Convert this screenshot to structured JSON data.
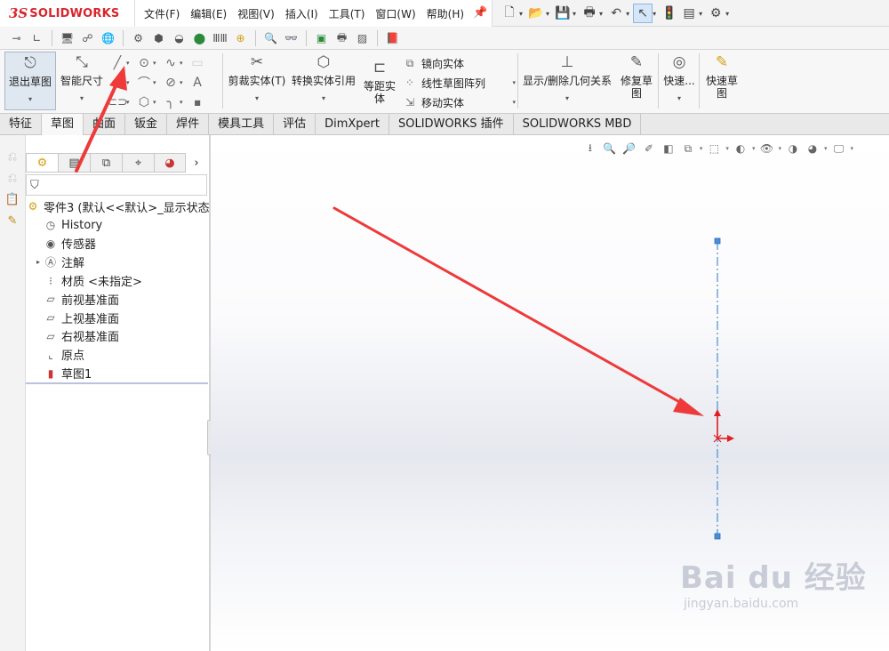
{
  "app": {
    "logo_ds": "3S",
    "logo_text": "SOLIDWORKS"
  },
  "menu": [
    "文件(F)",
    "编辑(E)",
    "视图(V)",
    "插入(I)",
    "工具(T)",
    "窗口(W)",
    "帮助(H)"
  ],
  "ribbon": {
    "exit_sketch": "退出草图",
    "smart_dim": "智能尺寸",
    "trim": "剪裁实体(T)",
    "convert": "转换实体引用",
    "offset_1": "等距实",
    "offset_2": "体",
    "mirror": "镜向实体",
    "linear_pattern": "线性草图阵列",
    "move": "移动实体",
    "display_relations": "显示/删除几何关系",
    "repair_1": "修复草",
    "repair_2": "图",
    "quick_snaps": "快速...",
    "rapid_1": "快速草",
    "rapid_2": "图"
  },
  "tabs": [
    "特征",
    "草图",
    "曲面",
    "钣金",
    "焊件",
    "模具工具",
    "评估",
    "DimXpert",
    "SOLIDWORKS 插件",
    "SOLIDWORKS MBD"
  ],
  "active_tab": "草图",
  "tree": {
    "part": "零件3  (默认<<默认>_显示状态",
    "items": [
      {
        "label": "History",
        "icon": "history-icon",
        "expandable": false
      },
      {
        "label": "传感器",
        "icon": "sensor-icon",
        "expandable": false
      },
      {
        "label": "注解",
        "icon": "annotation-icon",
        "expandable": true
      },
      {
        "label": "材质 <未指定>",
        "icon": "material-icon",
        "expandable": false
      },
      {
        "label": "前视基准面",
        "icon": "plane-icon",
        "expandable": false
      },
      {
        "label": "上视基准面",
        "icon": "plane-icon",
        "expandable": false
      },
      {
        "label": "右视基准面",
        "icon": "plane-icon",
        "expandable": false
      },
      {
        "label": "原点",
        "icon": "origin-icon",
        "expandable": false
      },
      {
        "label": "草图1",
        "icon": "sketch-icon",
        "expandable": false
      }
    ]
  },
  "watermark": {
    "main": "Bai du 经验",
    "sub": "jingyan.baidu.com"
  },
  "colors": {
    "brand": "#d7262c",
    "centerline": "#4a8fd6",
    "arrow": "#ee3a3a",
    "origin": "#e02020"
  }
}
